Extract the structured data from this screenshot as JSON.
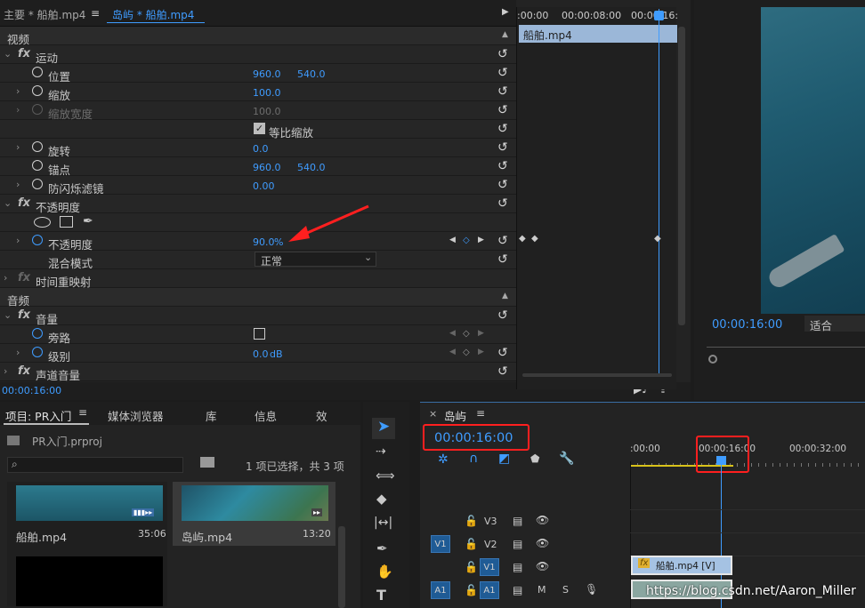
{
  "effect_controls": {
    "tab_main": "主要 * 船舶.mp4",
    "tab_active": "岛屿 * 船舶.mp4",
    "video_section": "视频",
    "motion": "运动",
    "position": "位置",
    "position_x": "960.0",
    "position_y": "540.0",
    "scale": "缩放",
    "scale_v": "100.0",
    "scale_width": "缩放宽度",
    "scale_width_v": "100.0",
    "uniform_scale": "等比缩放",
    "rotation": "旋转",
    "rotation_v": "0.0",
    "anchor": "锚点",
    "anchor_x": "960.0",
    "anchor_y": "540.0",
    "flicker": "防闪烁滤镜",
    "flicker_v": "0.00",
    "opacity_group": "不透明度",
    "opacity": "不透明度",
    "opacity_v": "90.0",
    "opacity_unit": "%",
    "blend": "混合模式",
    "blend_v": "正常",
    "time_remap": "时间重映射",
    "audio_section": "音频",
    "volume": "音量",
    "bypass": "旁路",
    "level": "级别",
    "level_v": "0.0",
    "level_unit": "dB",
    "channel_volume": "声道音量",
    "timecode": "00:00:16:00"
  },
  "mini_timeline": {
    "t0": ":00:00",
    "t1": "00:00:08:00",
    "t2": "00:00:16:",
    "clip": "船舶.mp4"
  },
  "program": {
    "timecode": "00:00:16:00",
    "fit": "适合"
  },
  "project": {
    "tab_project": "项目: PR入门",
    "tab_media": "媒体浏览器",
    "tab_lib": "库",
    "tab_info": "信息",
    "tab_fx": "效",
    "file": "PR入门.prproj",
    "selection": "1 项已选择，共 3 项",
    "items": [
      {
        "name": "船舶.mp4",
        "dur": "35:06"
      },
      {
        "name": "岛屿.mp4",
        "dur": "13:20"
      }
    ]
  },
  "timeline": {
    "close": "×",
    "name": "岛屿",
    "timecode": "00:00:16:00",
    "ruler": [
      ":00:00",
      "00:00:16:00",
      "00:00:32:00"
    ],
    "tracks": [
      "V3",
      "V2",
      "V1",
      "A1"
    ],
    "src_v": "V1",
    "src_a": "A1",
    "mute": "M",
    "solo": "S",
    "clip": "船舶.mp4 [V]",
    "watermark": "https://blog.csdn.net/Aaron_Miller"
  },
  "colors": {
    "accent": "#3f9cff",
    "highlight": "#ff1f1f"
  }
}
